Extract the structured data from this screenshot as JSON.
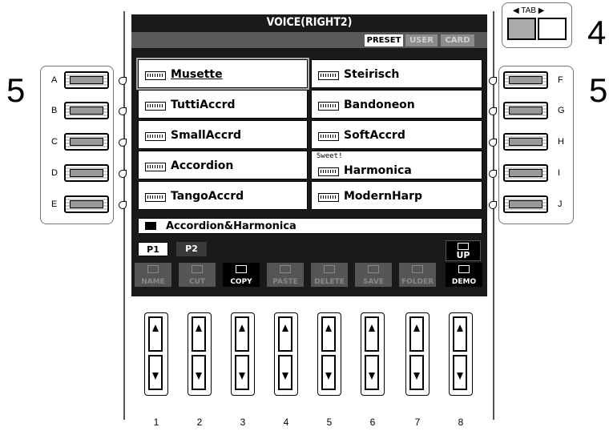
{
  "callouts": {
    "tab_number": "4",
    "left_number": "5",
    "right_number": "5"
  },
  "display": {
    "title": "VOICE(RIGHT2)",
    "tabs": [
      {
        "label": "PRESET",
        "selected": true
      },
      {
        "label": "USER",
        "selected": false
      },
      {
        "label": "CARD",
        "selected": false
      }
    ],
    "voices": [
      {
        "name": "Musette",
        "selected": true
      },
      {
        "name": "Steirisch"
      },
      {
        "name": "TuttiAccrd"
      },
      {
        "name": "Bandoneon"
      },
      {
        "name": "SmallAccrd"
      },
      {
        "name": "SoftAccrd"
      },
      {
        "name": "Accordion"
      },
      {
        "name": "Harmonica",
        "note": "Sweet!"
      },
      {
        "name": "TangoAccrd"
      },
      {
        "name": "ModernHarp"
      }
    ],
    "folder": "Accordion&Harmonica",
    "pages": [
      "P1",
      "P2"
    ],
    "up_label": "UP",
    "commands": [
      "NAME",
      "CUT",
      "COPY",
      "PASTE",
      "DELETE",
      "SAVE",
      "FOLDER",
      "DEMO"
    ]
  },
  "side_buttons": {
    "left": [
      "A",
      "B",
      "C",
      "D",
      "E"
    ],
    "right": [
      "F",
      "G",
      "H",
      "I",
      "J"
    ]
  },
  "tab_label": "TAB",
  "bottom_numbers": [
    "1",
    "2",
    "3",
    "4",
    "5",
    "6",
    "7",
    "8"
  ]
}
